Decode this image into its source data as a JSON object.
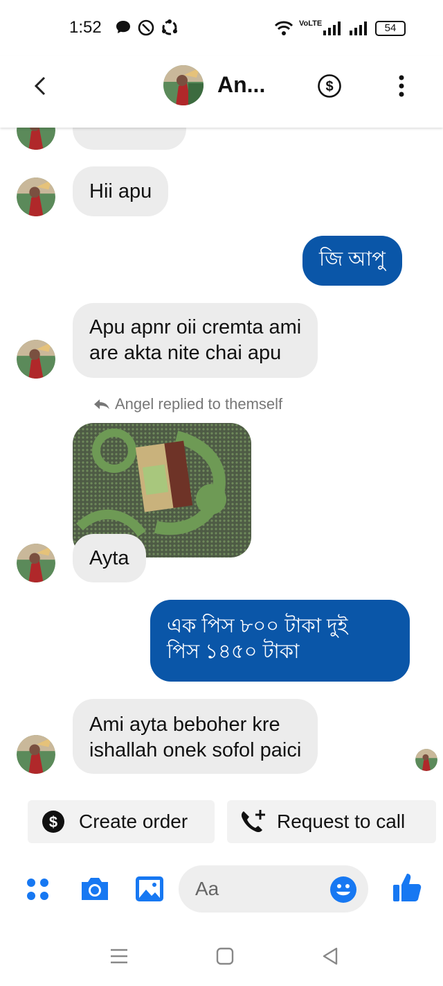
{
  "status_bar": {
    "time": "1:52",
    "network_label": "VoLTE",
    "battery": "54"
  },
  "header": {
    "contact_name": "An...",
    "icons": [
      "back-icon",
      "dollar-circle-icon",
      "more-vertical-icon"
    ]
  },
  "messages": [
    {
      "dir": "in",
      "text": "Hii apu"
    },
    {
      "dir": "out",
      "text": "জি আপু"
    },
    {
      "dir": "in",
      "lines": [
        "Apu apnr oii cremta ami",
        "are akta nite chai apu"
      ]
    },
    {
      "reply_label": "Angel replied to themself"
    },
    {
      "dir": "in",
      "text": "Ayta",
      "has_photo": true
    },
    {
      "dir": "out",
      "lines": [
        "এক পিস ৮০০ টাকা দুই",
        "পিস ১৪৫০ টাকা"
      ]
    },
    {
      "dir": "in",
      "lines": [
        "Ami ayta beboher kre",
        "ishallah onek sofol paici"
      ]
    }
  ],
  "quick_replies": [
    {
      "label": "Create order",
      "icon": "dollar-circle-icon"
    },
    {
      "label": "Request to call",
      "icon": "phone-plus-icon"
    }
  ],
  "composer": {
    "placeholder": "Aa",
    "icons": [
      "apps-icon",
      "camera-icon",
      "gallery-icon",
      "emoji-icon",
      "thumbs-up-icon"
    ]
  },
  "colors": {
    "accent": "#0a56a8",
    "icon_blue": "#1778f2",
    "incoming_bubble": "#ececec"
  }
}
